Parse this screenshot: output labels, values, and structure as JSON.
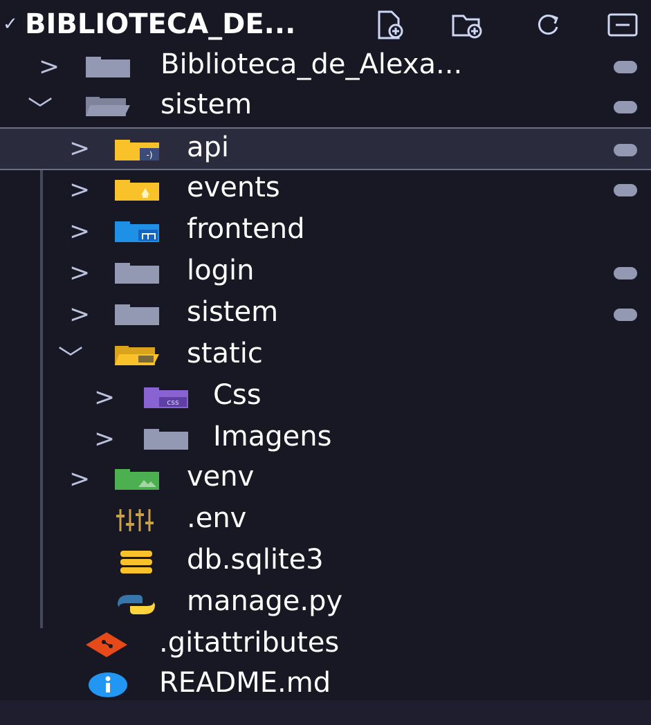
{
  "explorer": {
    "title": "BIBLIOTECA_DE...",
    "toolbar": {
      "new_file_icon": "new-file-icon",
      "new_folder_icon": "new-folder-icon",
      "refresh_icon": "refresh-icon",
      "collapse_icon": "collapse-all-icon"
    },
    "items": [
      {
        "label": "Biblioteca_de_Alexa...",
        "type": "folder",
        "icon": "folder-icon",
        "expanded": false,
        "modified": true
      },
      {
        "label": "sistem",
        "type": "folder",
        "icon": "folder-open-icon",
        "expanded": true,
        "modified": true
      },
      {
        "label": "api",
        "type": "folder",
        "icon": "folder-api-icon",
        "expanded": false,
        "modified": true,
        "selected": true
      },
      {
        "label": "events",
        "type": "folder",
        "icon": "folder-events-icon",
        "expanded": false,
        "modified": true
      },
      {
        "label": "frontend",
        "type": "folder",
        "icon": "folder-frontend-icon",
        "expanded": false,
        "modified": false
      },
      {
        "label": "login",
        "type": "folder",
        "icon": "folder-icon",
        "expanded": false,
        "modified": true
      },
      {
        "label": "sistem",
        "type": "folder",
        "icon": "folder-icon",
        "expanded": false,
        "modified": true
      },
      {
        "label": "static",
        "type": "folder",
        "icon": "folder-static-open-icon",
        "expanded": true,
        "modified": false
      },
      {
        "label": "Css",
        "type": "folder",
        "icon": "folder-css-icon",
        "expanded": false,
        "modified": false
      },
      {
        "label": "Imagens",
        "type": "folder",
        "icon": "folder-icon",
        "expanded": false,
        "modified": false
      },
      {
        "label": "venv",
        "type": "folder",
        "icon": "folder-venv-icon",
        "expanded": false,
        "modified": false
      },
      {
        "label": ".env",
        "type": "file",
        "icon": "env-settings-icon"
      },
      {
        "label": "db.sqlite3",
        "type": "file",
        "icon": "database-icon"
      },
      {
        "label": "manage.py",
        "type": "file",
        "icon": "python-icon"
      },
      {
        "label": ".gitattributes",
        "type": "file",
        "icon": "git-icon"
      },
      {
        "label": "README.md",
        "type": "file",
        "icon": "info-icon"
      }
    ]
  },
  "colors": {
    "background": "#181825",
    "selected_row": "#2a2b3d",
    "folder_gray": "#9399b2",
    "folder_yellow": "#f9c22b",
    "folder_blue": "#1e90e6",
    "folder_purple": "#8a63d2",
    "folder_green": "#4caf50",
    "git_red": "#e64a19",
    "info_blue": "#2196f3"
  }
}
